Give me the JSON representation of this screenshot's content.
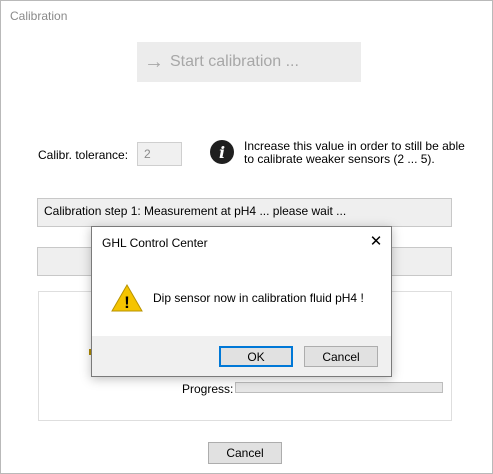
{
  "window": {
    "title": "Calibration"
  },
  "start_button": {
    "label": "Start calibration ...",
    "arrow_icon": "arrow-right-icon"
  },
  "tolerance": {
    "label": "Calibr. tolerance:",
    "value": "2",
    "info_glyph": "i",
    "hint": "Increase this value in order to still be able to calibrate weaker sensors (2 ... 5)."
  },
  "status": {
    "line1": "Calibration step 1: Measurement at pH4 ... please wait ...",
    "line2": ""
  },
  "progress": {
    "label": "Progress:",
    "fraction": 0.0
  },
  "footer": {
    "cancel_label": "Cancel"
  },
  "dialog": {
    "title": "GHL Control Center",
    "close_glyph": "✕",
    "message": "Dip sensor now in calibration fluid pH4 !",
    "ok_label": "OK",
    "cancel_label": "Cancel",
    "warning_mark": "!",
    "warning_color": "#f5c400"
  }
}
